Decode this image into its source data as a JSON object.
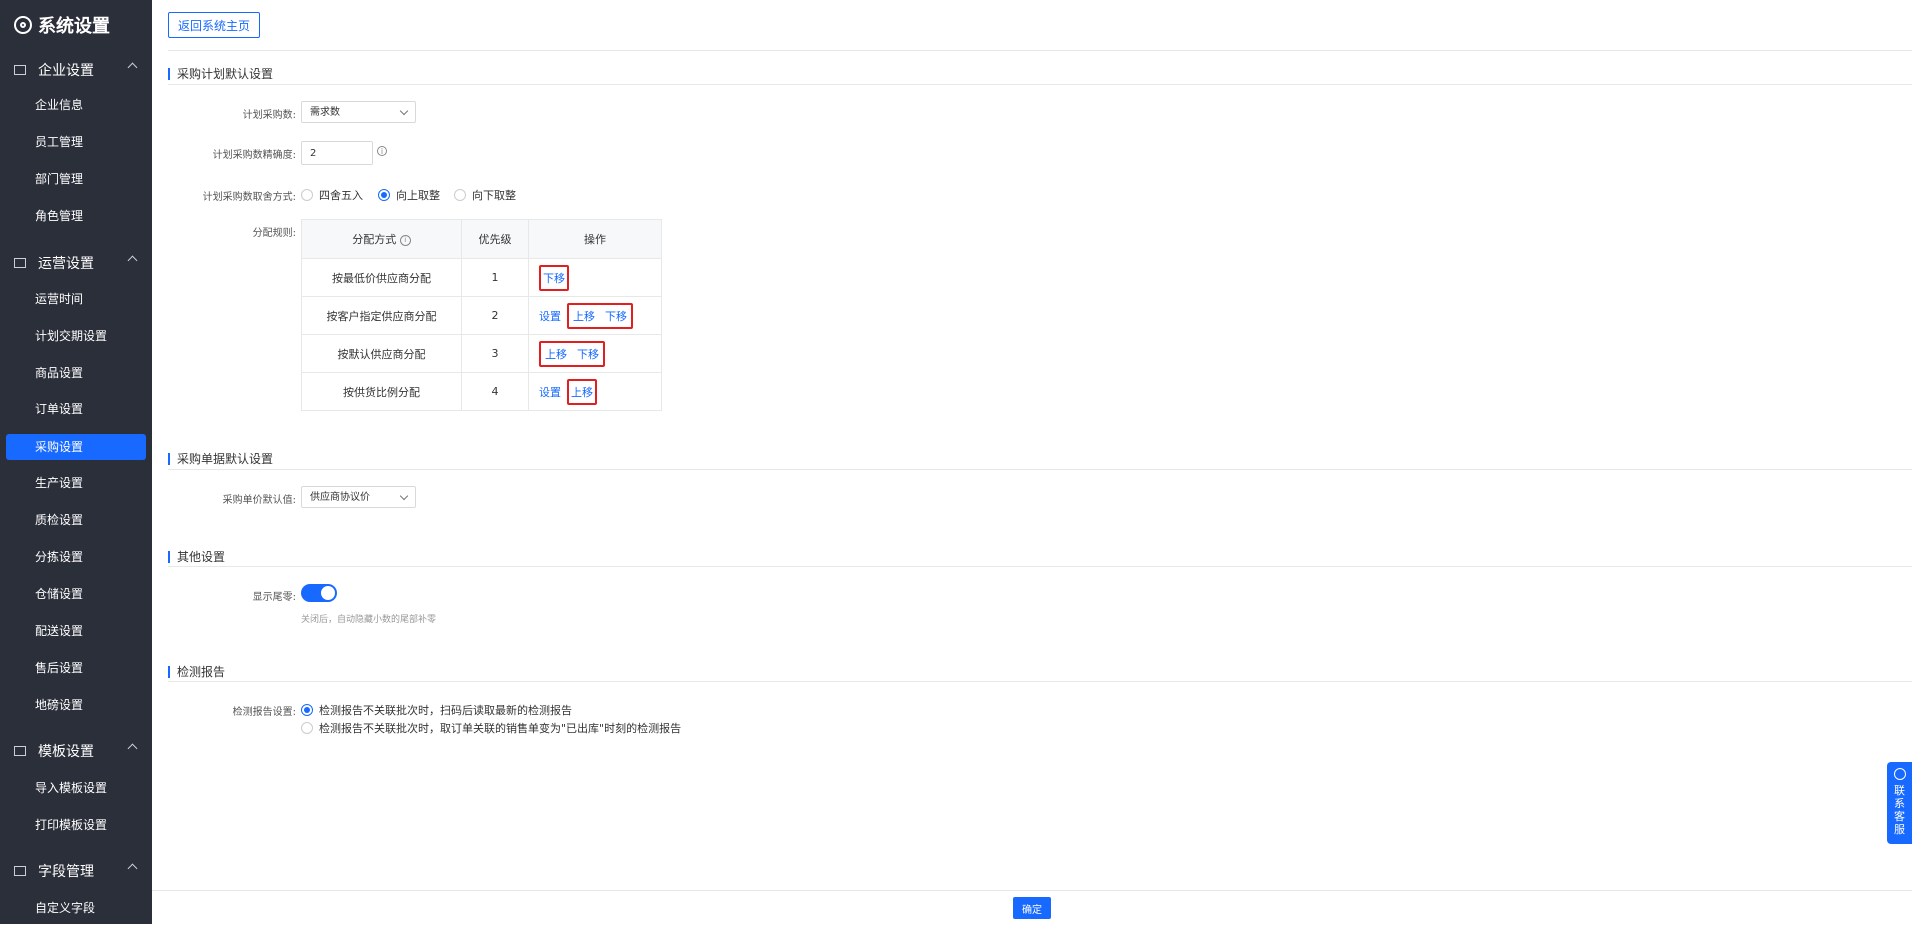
{
  "sidebar": {
    "title": "系统设置",
    "groups": [
      {
        "label": "企业设置",
        "items": [
          "企业信息",
          "员工管理",
          "部门管理",
          "角色管理"
        ]
      },
      {
        "label": "运营设置",
        "items": [
          "运营时间",
          "计划交期设置",
          "商品设置",
          "订单设置",
          "采购设置",
          "生产设置",
          "质检设置",
          "分拣设置",
          "仓储设置",
          "配送设置",
          "售后设置",
          "地磅设置"
        ]
      },
      {
        "label": "模板设置",
        "items": [
          "导入模板设置",
          "打印模板设置"
        ]
      },
      {
        "label": "字段管理",
        "items": [
          "自定义字段"
        ]
      }
    ],
    "active_item": "采购设置"
  },
  "header": {
    "back_button": "返回系统主页"
  },
  "purchase_plan": {
    "section_title": "采购计划默认设置",
    "plan_qty_label": "计划采购数:",
    "plan_qty_value": "需求数",
    "precision_label": "计划采购数精确度:",
    "precision_value": "2",
    "rounding_label": "计划采购数取舍方式:",
    "rounding_options": [
      "四舍五入",
      "向上取整",
      "向下取整"
    ],
    "rounding_selected": "向上取整",
    "rules_label": "分配规则:",
    "table_headers": [
      "分配方式",
      "优先级",
      "操作"
    ],
    "rows": [
      {
        "method": "按最低价供应商分配",
        "priority": "1",
        "ops": [
          "下移"
        ]
      },
      {
        "method": "按客户指定供应商分配",
        "priority": "2",
        "ops": [
          "设置",
          "上移",
          "下移"
        ]
      },
      {
        "method": "按默认供应商分配",
        "priority": "3",
        "ops": [
          "上移",
          "下移"
        ]
      },
      {
        "method": "按供货比例分配",
        "priority": "4",
        "ops": [
          "设置",
          "上移"
        ]
      }
    ]
  },
  "purchase_doc": {
    "section_title": "采购单据默认设置",
    "price_label": "采购单价默认值:",
    "price_value": "供应商协议价"
  },
  "other": {
    "section_title": "其他设置",
    "tail_zero_label": "显示尾零:",
    "tail_zero_on": true,
    "tail_zero_hint": "关闭后，自动隐藏小数的尾部补零"
  },
  "report": {
    "section_title": "检测报告",
    "label": "检测报告设置:",
    "options": [
      "检测报告不关联批次时，扫码后读取最新的检测报告",
      "检测报告不关联批次时，取订单关联的销售单变为\"已出库\"时刻的检测报告"
    ],
    "selected_index": 0
  },
  "footer": {
    "ok_button": "确定"
  },
  "service": {
    "label": "联系客服"
  },
  "colors": {
    "accent": "#1769ff",
    "sidebar_bg": "#2b2f3a",
    "highlight": "#e02020"
  }
}
